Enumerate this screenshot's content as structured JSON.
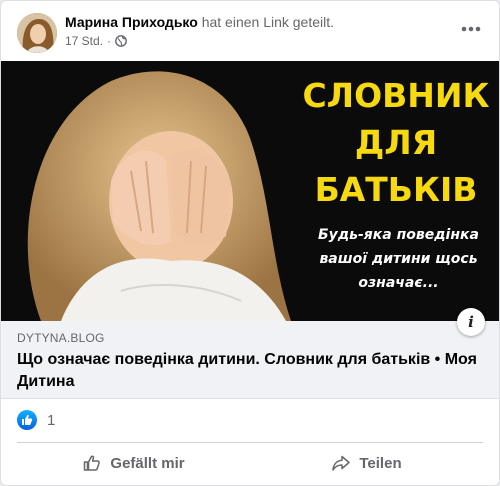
{
  "post": {
    "author_name": "Марина Приходько",
    "action_text": "hat einen Link geteilt.",
    "timestamp": "17 Std.",
    "separator": "·",
    "privacy_icon": "globe-icon",
    "more_icon": "more-options-icon"
  },
  "link": {
    "image": {
      "headline_lines": [
        "СЛОВНИК",
        "ДЛЯ",
        "БАТЬКІВ"
      ],
      "subline_lines": [
        "Будь-яка поведінка",
        "вашої дитини щось",
        "означає..."
      ],
      "headline_color": "#f7d90f"
    },
    "domain": "DYTYNA.BLOG",
    "title": "Що означає поведінка дитини. Словник для батьків • Моя Дитина",
    "info_icon": "info-icon"
  },
  "reactions": {
    "icon": "like-reaction-icon",
    "count": "1"
  },
  "actions": {
    "like_label": "Gefällt mir",
    "share_label": "Teilen"
  },
  "colors": {
    "brand_blue": "#1877f2",
    "secondary_text": "#65676b"
  }
}
